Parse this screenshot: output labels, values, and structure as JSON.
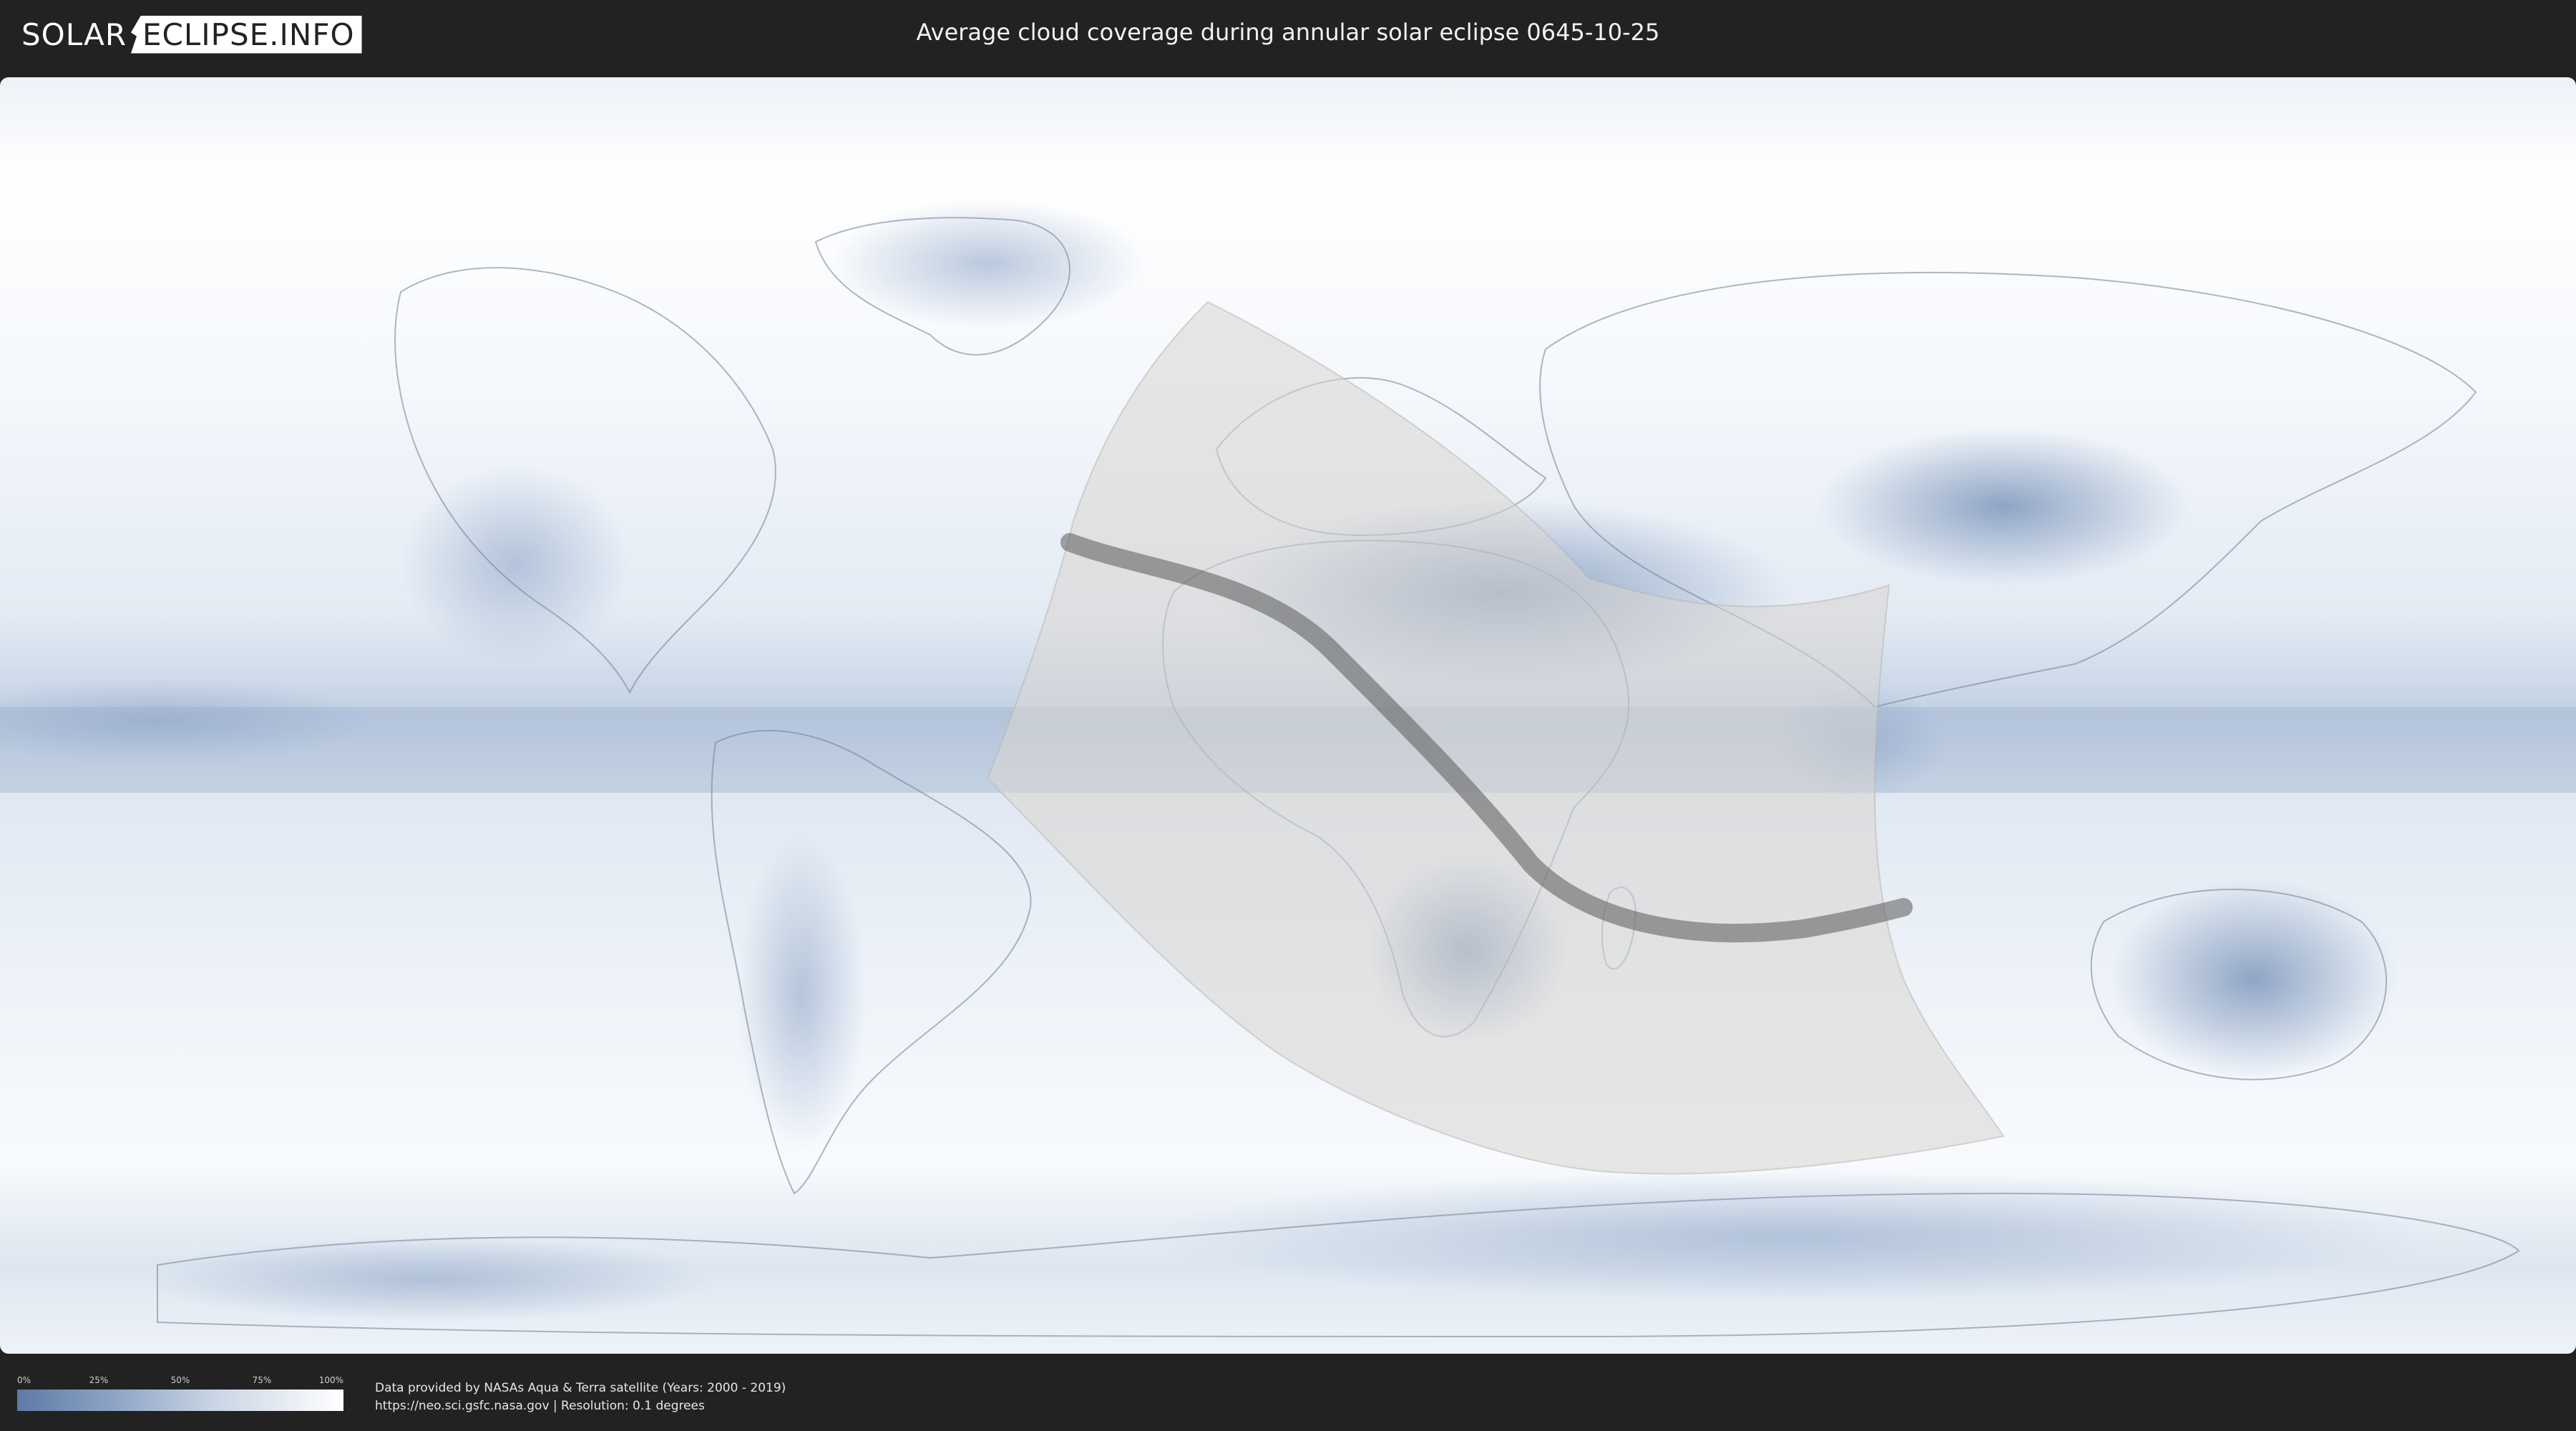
{
  "header": {
    "logo": {
      "part1": "SOLAR",
      "part2": "ECLIPSE.INFO"
    },
    "title": "Average cloud coverage during annular solar eclipse 0645-10-25"
  },
  "map": {
    "colors": {
      "ocean_clouds": "#e8eef6",
      "cloud_dark": "#5d7aa6",
      "cloud_mid": "#9fb3d1",
      "cloud_light": "#ffffff",
      "eclipse_zone": "#d9d6d2",
      "central_path": "#5a5a5a",
      "coastline": "#6f7d92"
    }
  },
  "legend": {
    "ticks": [
      "0%",
      "25%",
      "50%",
      "75%",
      "100%"
    ]
  },
  "credits": {
    "line1": "Data provided by NASAs Aqua & Terra satellite (Years: 2000 - 2019)",
    "line2": "https://neo.sci.gsfc.nasa.gov | Resolution: 0.1 degrees"
  }
}
